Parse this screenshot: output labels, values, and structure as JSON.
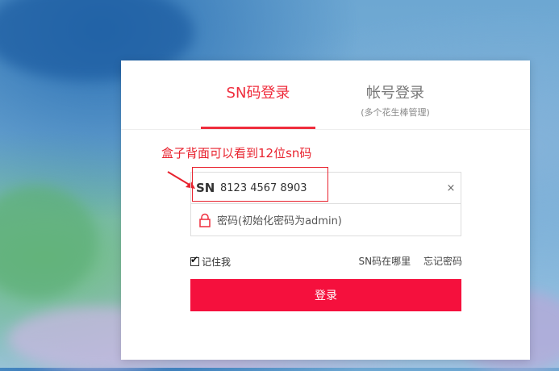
{
  "tabs": {
    "sn_login": "SN码登录",
    "account_login": "帐号登录",
    "account_login_sub": "(多个花生棒管理)"
  },
  "hint": "盒子背面可以看到12位sn码",
  "sn_field": {
    "prefix": "SN",
    "value": "8123 4567 8903",
    "clear": "×"
  },
  "password_field": {
    "placeholder": "密码(初始化密码为admin)"
  },
  "remember_me": "记住我",
  "links": {
    "where_sn": "SN码在哪里",
    "forgot_password": "忘记密码"
  },
  "login_button": "登录",
  "colors": {
    "accent": "#ef2d3d",
    "button": "#f5103d"
  }
}
